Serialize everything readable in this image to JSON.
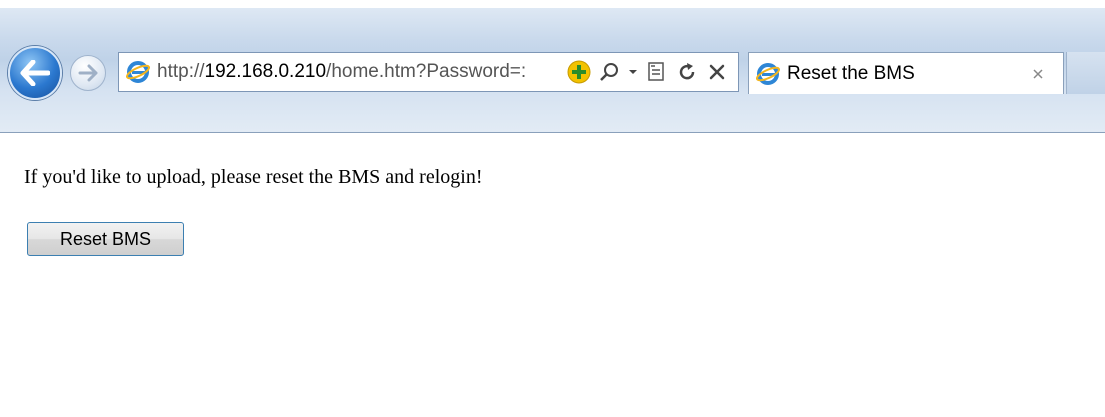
{
  "browser": {
    "address": {
      "scheme": "http://",
      "host": "192.168.0.210",
      "path": "/home.htm?Password=:"
    },
    "tab": {
      "title": "Reset the BMS"
    },
    "icons": {
      "back": "back-arrow-icon",
      "forward": "forward-arrow-icon",
      "site": "ie-logo-icon",
      "compatibility": "add-green-icon",
      "search": "search-icon",
      "dropdown": "chevron-down-icon",
      "compat_view": "compatibility-view-icon",
      "refresh": "refresh-icon",
      "stop": "close-icon"
    },
    "colors": {
      "back_button": "#2b78cf",
      "accent_green": "#f2c200"
    }
  },
  "page": {
    "message": "If you'd like to upload, please reset the BMS and relogin!",
    "reset_button_label": "Reset BMS"
  }
}
